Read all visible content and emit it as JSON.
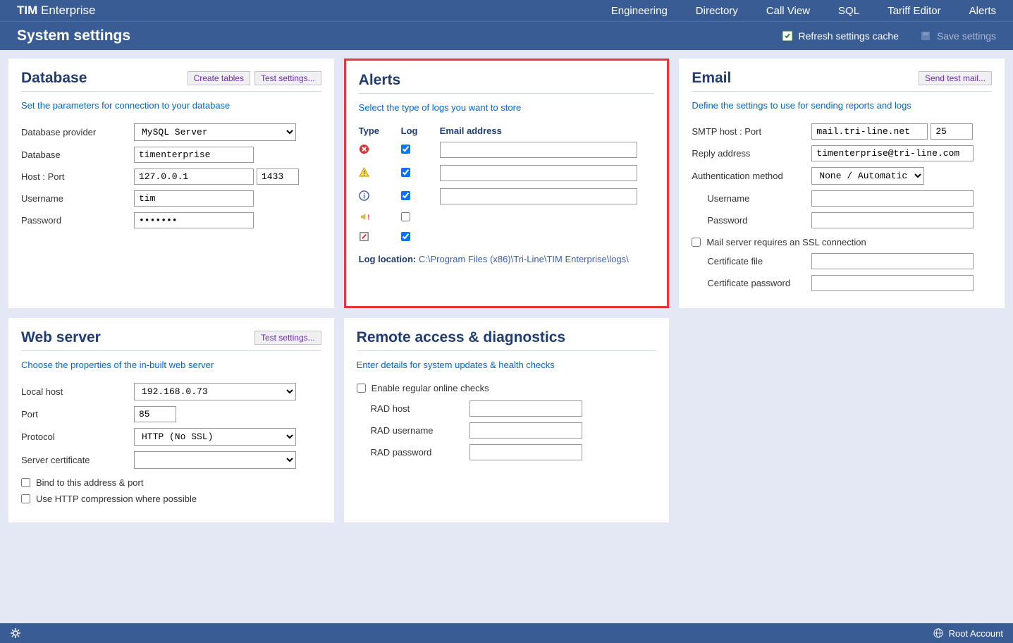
{
  "brand_prefix": "TIM",
  "brand_suffix": "Enterprise",
  "nav": [
    "Engineering",
    "Directory",
    "Call View",
    "SQL",
    "Tariff Editor",
    "Alerts"
  ],
  "page_title": "System settings",
  "actions": {
    "refresh": "Refresh settings cache",
    "save": "Save settings"
  },
  "panels": {
    "database": {
      "title": "Database",
      "btns": [
        "Create tables",
        "Test settings..."
      ],
      "desc": "Set the parameters for connection to your database",
      "provider_label": "Database provider",
      "provider_value": "MySQL Server",
      "db_label": "Database",
      "db_value": "timenterprise",
      "host_label": "Host : Port",
      "host_value": "127.0.0.1",
      "port_value": "1433",
      "user_label": "Username",
      "user_value": "tim",
      "pass_label": "Password",
      "pass_value": "•••••••"
    },
    "alerts": {
      "title": "Alerts",
      "desc": "Select the type of logs you want to store",
      "col_type": "Type",
      "col_log": "Log",
      "col_email": "Email address",
      "rows": [
        {
          "log": true,
          "has_email": true
        },
        {
          "log": true,
          "has_email": true
        },
        {
          "log": true,
          "has_email": true
        },
        {
          "log": false,
          "has_email": false
        },
        {
          "log": true,
          "has_email": false
        }
      ],
      "loc_label": "Log location:",
      "loc_path": "C:\\Program Files (x86)\\Tri-Line\\TIM Enterprise\\logs\\"
    },
    "email": {
      "title": "Email",
      "btn": "Send test mail...",
      "desc": "Define the settings to use for sending reports and logs",
      "smtp_label": "SMTP host : Port",
      "smtp_value": "mail.tri-line.net",
      "smtp_port": "25",
      "reply_label": "Reply address",
      "reply_value": "timenterprise@tri-line.com",
      "auth_label": "Authentication method",
      "auth_value": "None / Automatic",
      "user_label": "Username",
      "pass_label": "Password",
      "ssl_label": "Mail server requires an SSL connection",
      "cert_label": "Certificate file",
      "certpass_label": "Certificate password"
    },
    "web": {
      "title": "Web server",
      "btn": "Test settings...",
      "desc": "Choose the properties of the in-built web server",
      "local_label": "Local host",
      "local_value": "192.168.0.73",
      "port_label": "Port",
      "port_value": "85",
      "proto_label": "Protocol",
      "proto_value": "HTTP (No SSL)",
      "cert_label": "Server certificate",
      "bind_label": "Bind to this address & port",
      "compress_label": "Use HTTP compression where possible"
    },
    "remote": {
      "title": "Remote access & diagnostics",
      "desc": "Enter details for system updates & health checks",
      "enable_label": "Enable regular online checks",
      "host_label": "RAD host",
      "user_label": "RAD username",
      "pass_label": "RAD password"
    }
  },
  "footer": {
    "account": "Root Account"
  }
}
